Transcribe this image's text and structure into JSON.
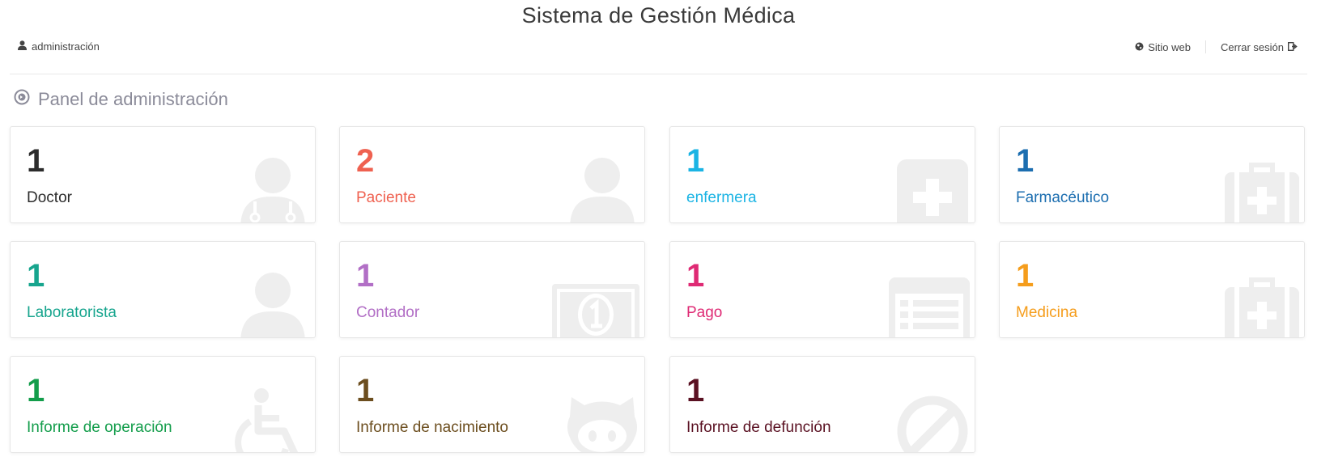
{
  "header": {
    "title": "Sistema de Gestión Médica",
    "user": {
      "name": "administración",
      "icon": "user-icon"
    },
    "links": [
      {
        "label": "Sitio web",
        "icon": "globe-icon"
      },
      {
        "label": "Cerrar sesión",
        "icon": "logout-icon"
      }
    ]
  },
  "section": {
    "title": "Panel de administración",
    "icon": "arrow-circle-icon"
  },
  "colors": {
    "icon_bg": "#eeeeee"
  },
  "cards": [
    {
      "count": "1",
      "label": "Doctor",
      "color": "#2c2c2c",
      "icon": "doctor-icon"
    },
    {
      "count": "2",
      "label": "Paciente",
      "color": "#ef6150",
      "icon": "user-icon"
    },
    {
      "count": "1",
      "label": "enfermera",
      "color": "#1bb4e4",
      "icon": "medical-plus-icon"
    },
    {
      "count": "1",
      "label": "Farmacéutico",
      "color": "#1c6eb0",
      "icon": "medkit-icon"
    },
    {
      "count": "1",
      "label": "Laboratorista",
      "color": "#17a58e",
      "icon": "user-icon"
    },
    {
      "count": "1",
      "label": "Contador",
      "color": "#b26fc6",
      "icon": "money-icon"
    },
    {
      "count": "1",
      "label": "Pago",
      "color": "#df2a74",
      "icon": "list-alt-icon"
    },
    {
      "count": "1",
      "label": "Medicina",
      "color": "#f59d1c",
      "icon": "medkit-icon"
    },
    {
      "count": "1",
      "label": "Informe de operación",
      "color": "#139d4b",
      "icon": "wheelchair-icon"
    },
    {
      "count": "1",
      "label": "Informe de nacimiento",
      "color": "#6c4e1f",
      "icon": "github-icon"
    },
    {
      "count": "1",
      "label": "Informe de defunción",
      "color": "#5a1122",
      "icon": "ban-icon"
    }
  ]
}
